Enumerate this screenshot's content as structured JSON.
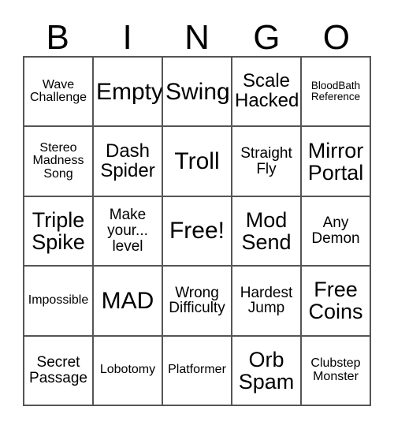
{
  "card": {
    "title": "BINGO",
    "header_letters": [
      "B",
      "I",
      "N",
      "G",
      "O"
    ],
    "background_color": "#ffffff",
    "text_color": "#000000",
    "grid_line_color": "#555555",
    "rows": 5,
    "columns": 5,
    "free_space_label": "Free!",
    "free_space_position": "2,2",
    "cells": [
      [
        {
          "text": "Wave\nChallenge",
          "size": "sm"
        },
        {
          "text": "Empty",
          "size": "xxl"
        },
        {
          "text": "Swing",
          "size": "xxl"
        },
        {
          "text": "Scale\nHacked",
          "size": "lg"
        },
        {
          "text": "BloodBath\nReference",
          "size": "xs"
        }
      ],
      [
        {
          "text": "Stereo\nMadness\nSong",
          "size": "sm"
        },
        {
          "text": "Dash\nSpider",
          "size": "lg"
        },
        {
          "text": "Troll",
          "size": "xxl"
        },
        {
          "text": "Straight\nFly",
          "size": "md"
        },
        {
          "text": "Mirror\nPortal",
          "size": "xl"
        }
      ],
      [
        {
          "text": "Triple\nSpike",
          "size": "xl"
        },
        {
          "text": "Make\nyour...\nlevel",
          "size": "md"
        },
        {
          "text": "Free!",
          "size": "xxl"
        },
        {
          "text": "Mod\nSend",
          "size": "xl"
        },
        {
          "text": "Any\nDemon",
          "size": "md"
        }
      ],
      [
        {
          "text": "Impossible",
          "size": "sm"
        },
        {
          "text": "MAD",
          "size": "xxl"
        },
        {
          "text": "Wrong\nDifficulty",
          "size": "md"
        },
        {
          "text": "Hardest\nJump",
          "size": "md"
        },
        {
          "text": "Free\nCoins",
          "size": "xl"
        }
      ],
      [
        {
          "text": "Secret\nPassage",
          "size": "md"
        },
        {
          "text": "Lobotomy",
          "size": "sm"
        },
        {
          "text": "Platformer",
          "size": "sm"
        },
        {
          "text": "Orb\nSpam",
          "size": "xl"
        },
        {
          "text": "Clubstep\nMonster",
          "size": "sm"
        }
      ]
    ]
  }
}
